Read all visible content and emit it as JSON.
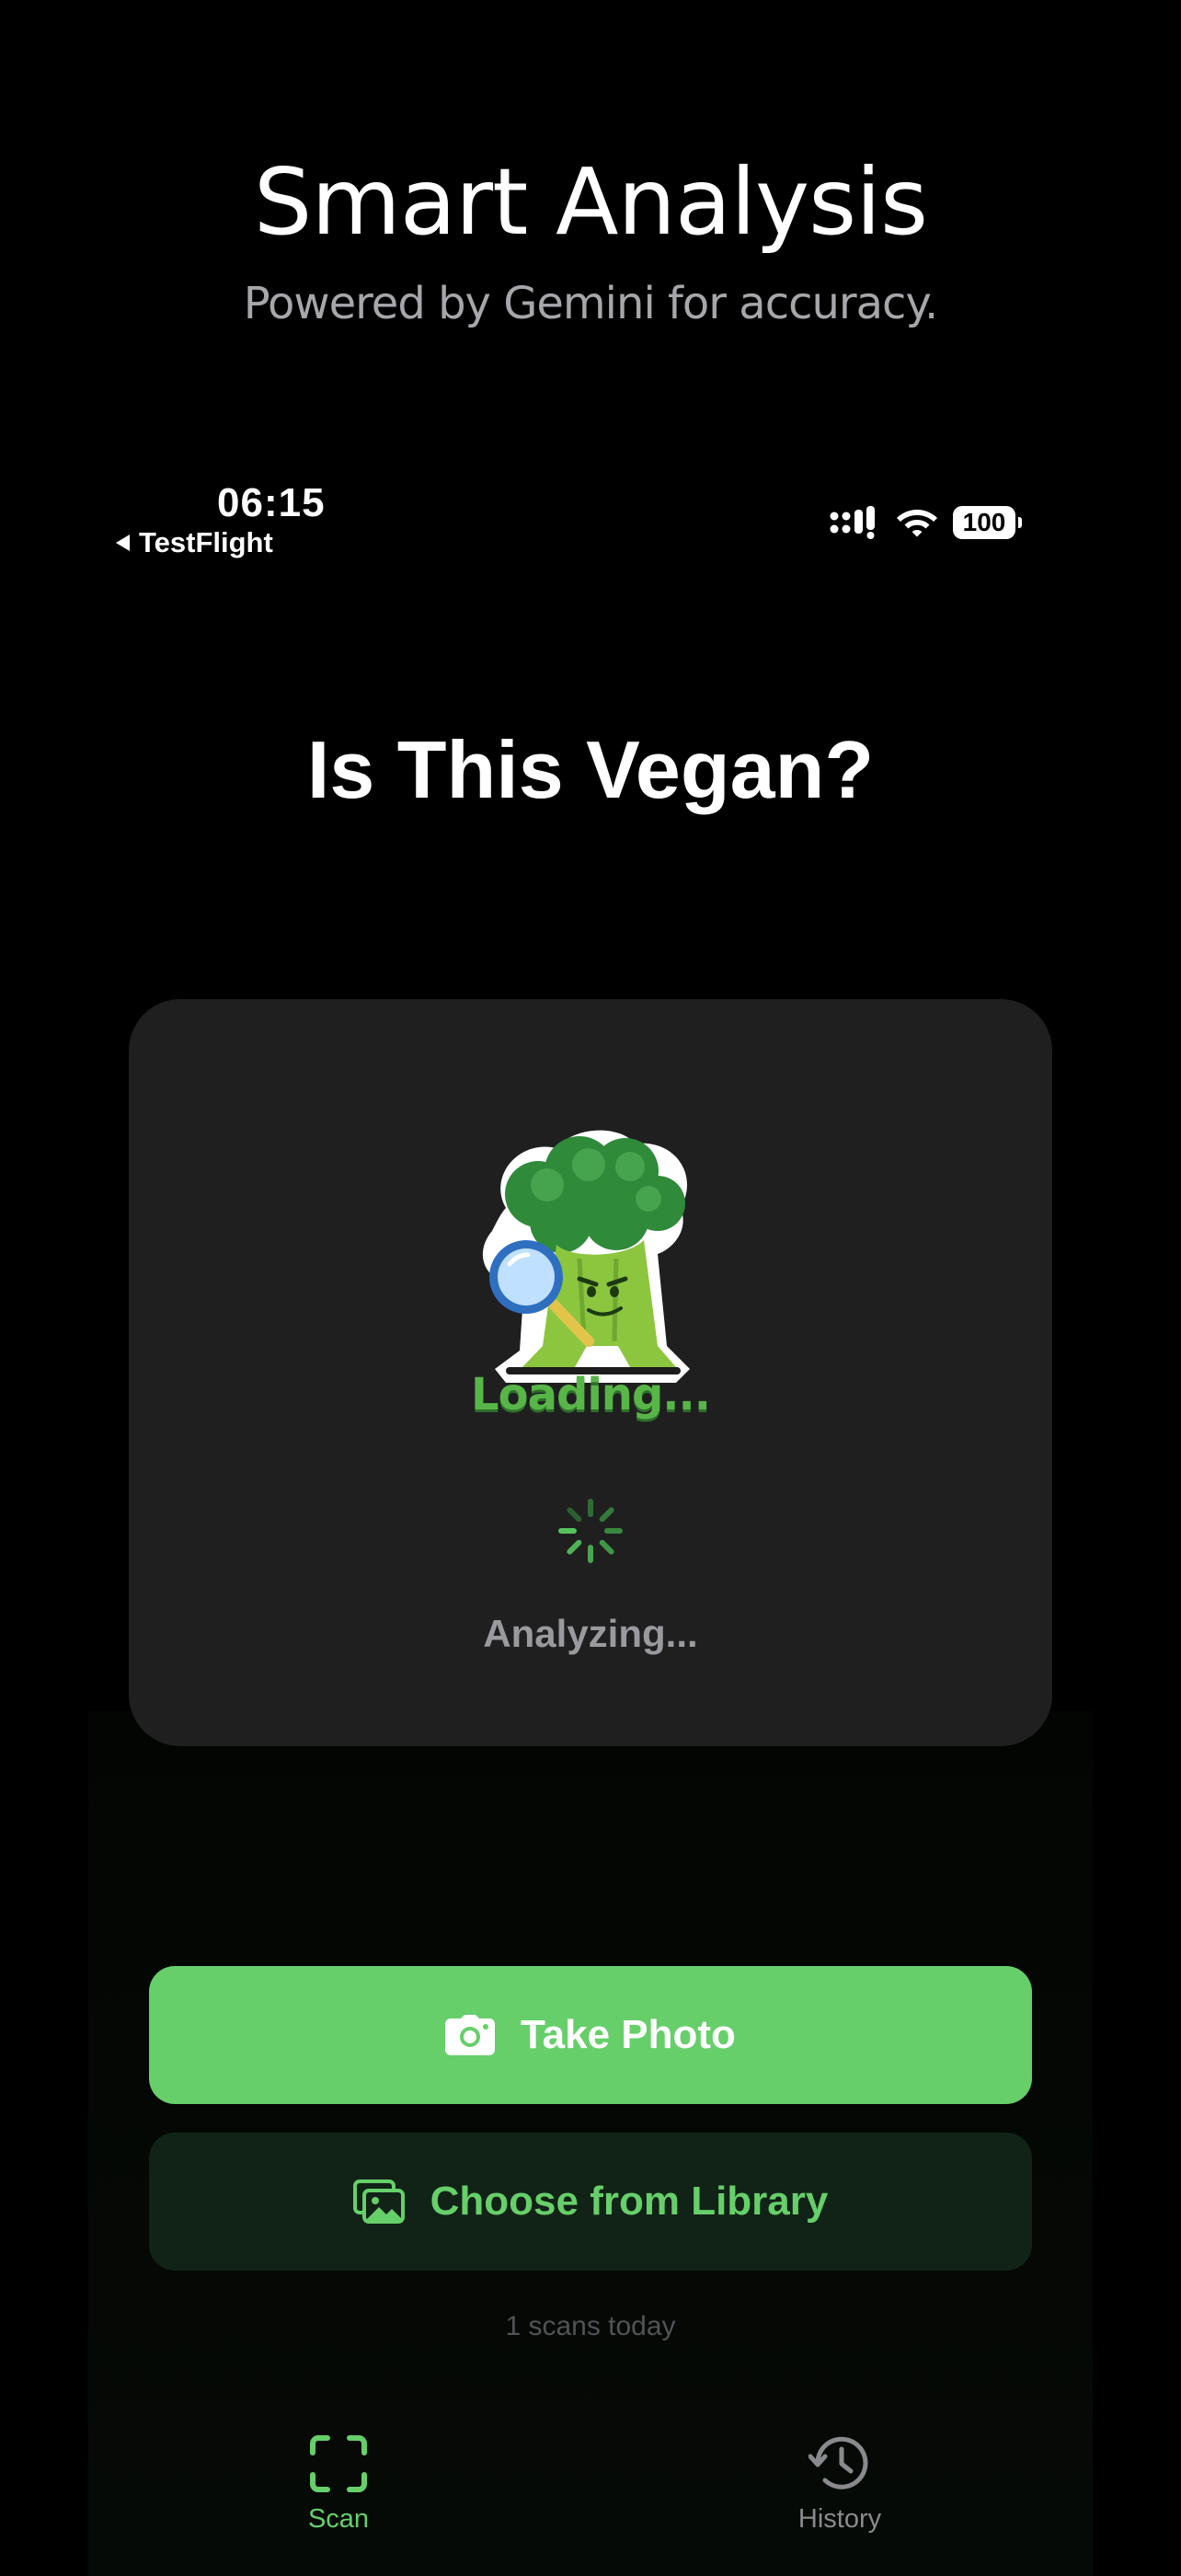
{
  "promo": {
    "title": "Smart Analysis",
    "subtitle": "Powered by Gemini for accuracy."
  },
  "status_bar": {
    "time": "06:15",
    "back_app": "TestFlight",
    "battery": "100",
    "icons": [
      "signal-icon",
      "wifi-icon",
      "battery-icon"
    ]
  },
  "screen": {
    "title": "Is This Vegan?"
  },
  "analysis_card": {
    "mascot": "broccoli-magnifier-mascot",
    "loading_text": "Loading...",
    "status_text": "Analyzing..."
  },
  "actions": {
    "take_photo": "Take Photo",
    "choose_library": "Choose from Library",
    "scans_today": "1 scans today"
  },
  "tab_bar": {
    "tabs": [
      {
        "label": "Scan",
        "icon": "scan-frame-icon",
        "active": true
      },
      {
        "label": "History",
        "icon": "history-clock-icon",
        "active": false
      }
    ]
  },
  "colors": {
    "accent": "#66cf6a",
    "card_background": "#1f1f20",
    "secondary_button": "#112216",
    "muted_text": "#9a9a9e"
  }
}
